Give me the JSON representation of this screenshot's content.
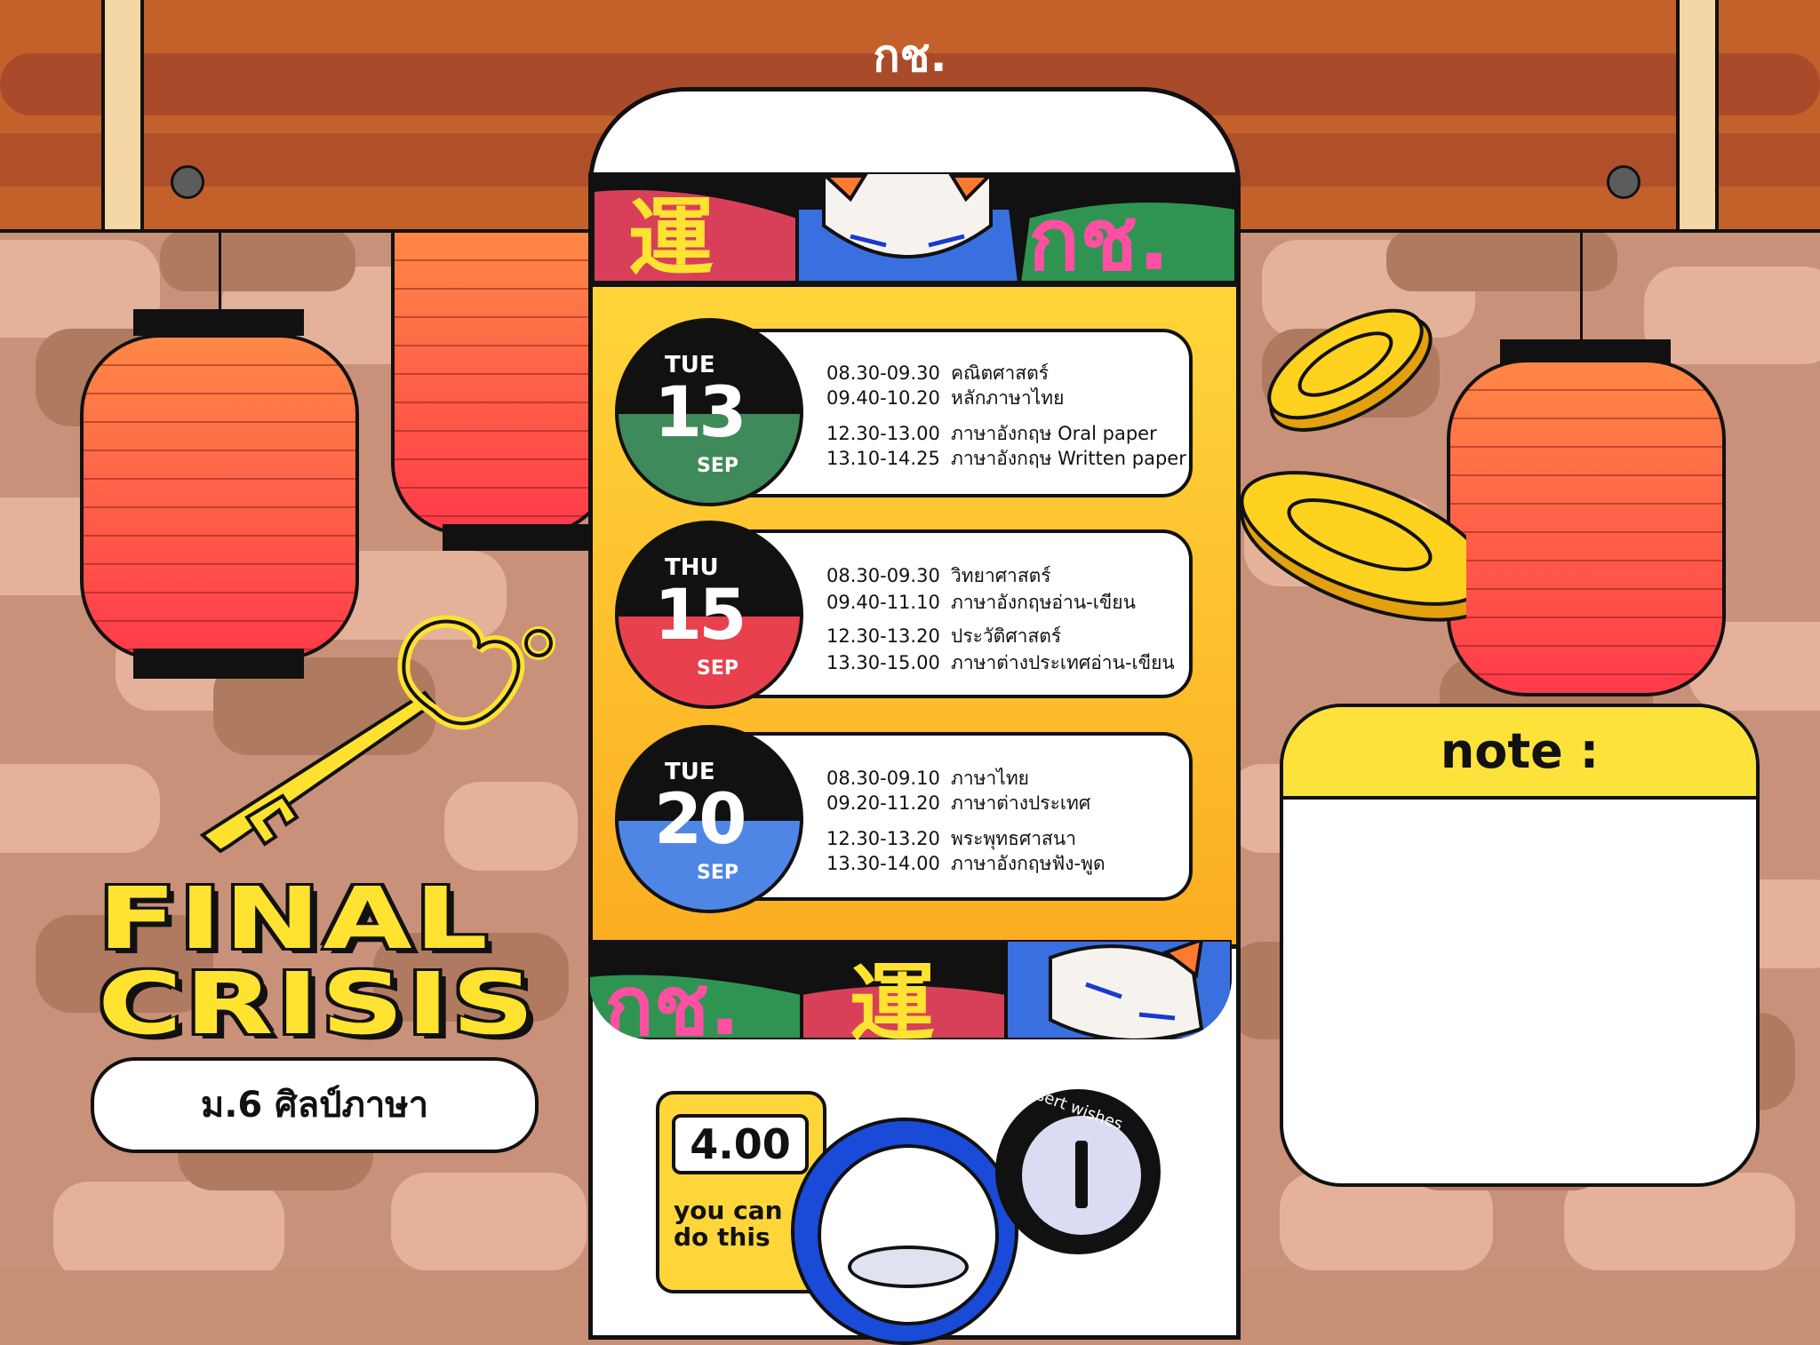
{
  "board": {
    "title": "กช."
  },
  "schedule": [
    {
      "day": "TUE",
      "date": "13",
      "month": "SEP",
      "color": "#3f8a5a",
      "rows": [
        {
          "time": "08.30-09.30",
          "subject": "คณิตศาสตร์"
        },
        {
          "time": "09.40-10.20",
          "subject": "หลักภาษาไทย"
        },
        {
          "time": "12.30-13.00",
          "subject": "ภาษาอังกฤษ Oral paper"
        },
        {
          "time": "13.10-14.25",
          "subject": "ภาษาอังกฤษ Written paper"
        }
      ]
    },
    {
      "day": "THU",
      "date": "15",
      "month": "SEP",
      "color": "#e8404c",
      "rows": [
        {
          "time": "08.30-09.30",
          "subject": "วิทยาศาสตร์"
        },
        {
          "time": "09.40-11.10",
          "subject": "ภาษาอังกฤษอ่าน-เขียน"
        },
        {
          "time": "12.30-13.20",
          "subject": "ประวัติศาสตร์"
        },
        {
          "time": "13.30-15.00",
          "subject": "ภาษาต่างประเทศอ่าน-เขียน"
        }
      ]
    },
    {
      "day": "TUE",
      "date": "20",
      "month": "SEP",
      "color": "#4f86e6",
      "rows": [
        {
          "time": "08.30-09.10",
          "subject": "ภาษาไทย"
        },
        {
          "time": "09.20-11.20",
          "subject": "ภาษาต่างประเทศ"
        },
        {
          "time": "12.30-13.20",
          "subject": "พระพุทธศาสนา"
        },
        {
          "time": "13.30-14.00",
          "subject": "ภาษาอังกฤษฟัง-พูด"
        }
      ]
    }
  ],
  "decor": {
    "kanji": "運",
    "brand": "กช."
  },
  "title": {
    "line1": "FINAL",
    "line2": "CRISIS",
    "subtitle": "ม.6 ศิลป์ภาษา"
  },
  "note": {
    "label": "note :"
  },
  "machine": {
    "price": "4.00",
    "motto_line1": "you can",
    "motto_line2": "do this",
    "slot_label": "insert wishes"
  },
  "colors": {
    "board": "#c4602a",
    "yellow": "#ffd53a",
    "lantern": "#ff5044",
    "coin": "#f7c51c"
  }
}
